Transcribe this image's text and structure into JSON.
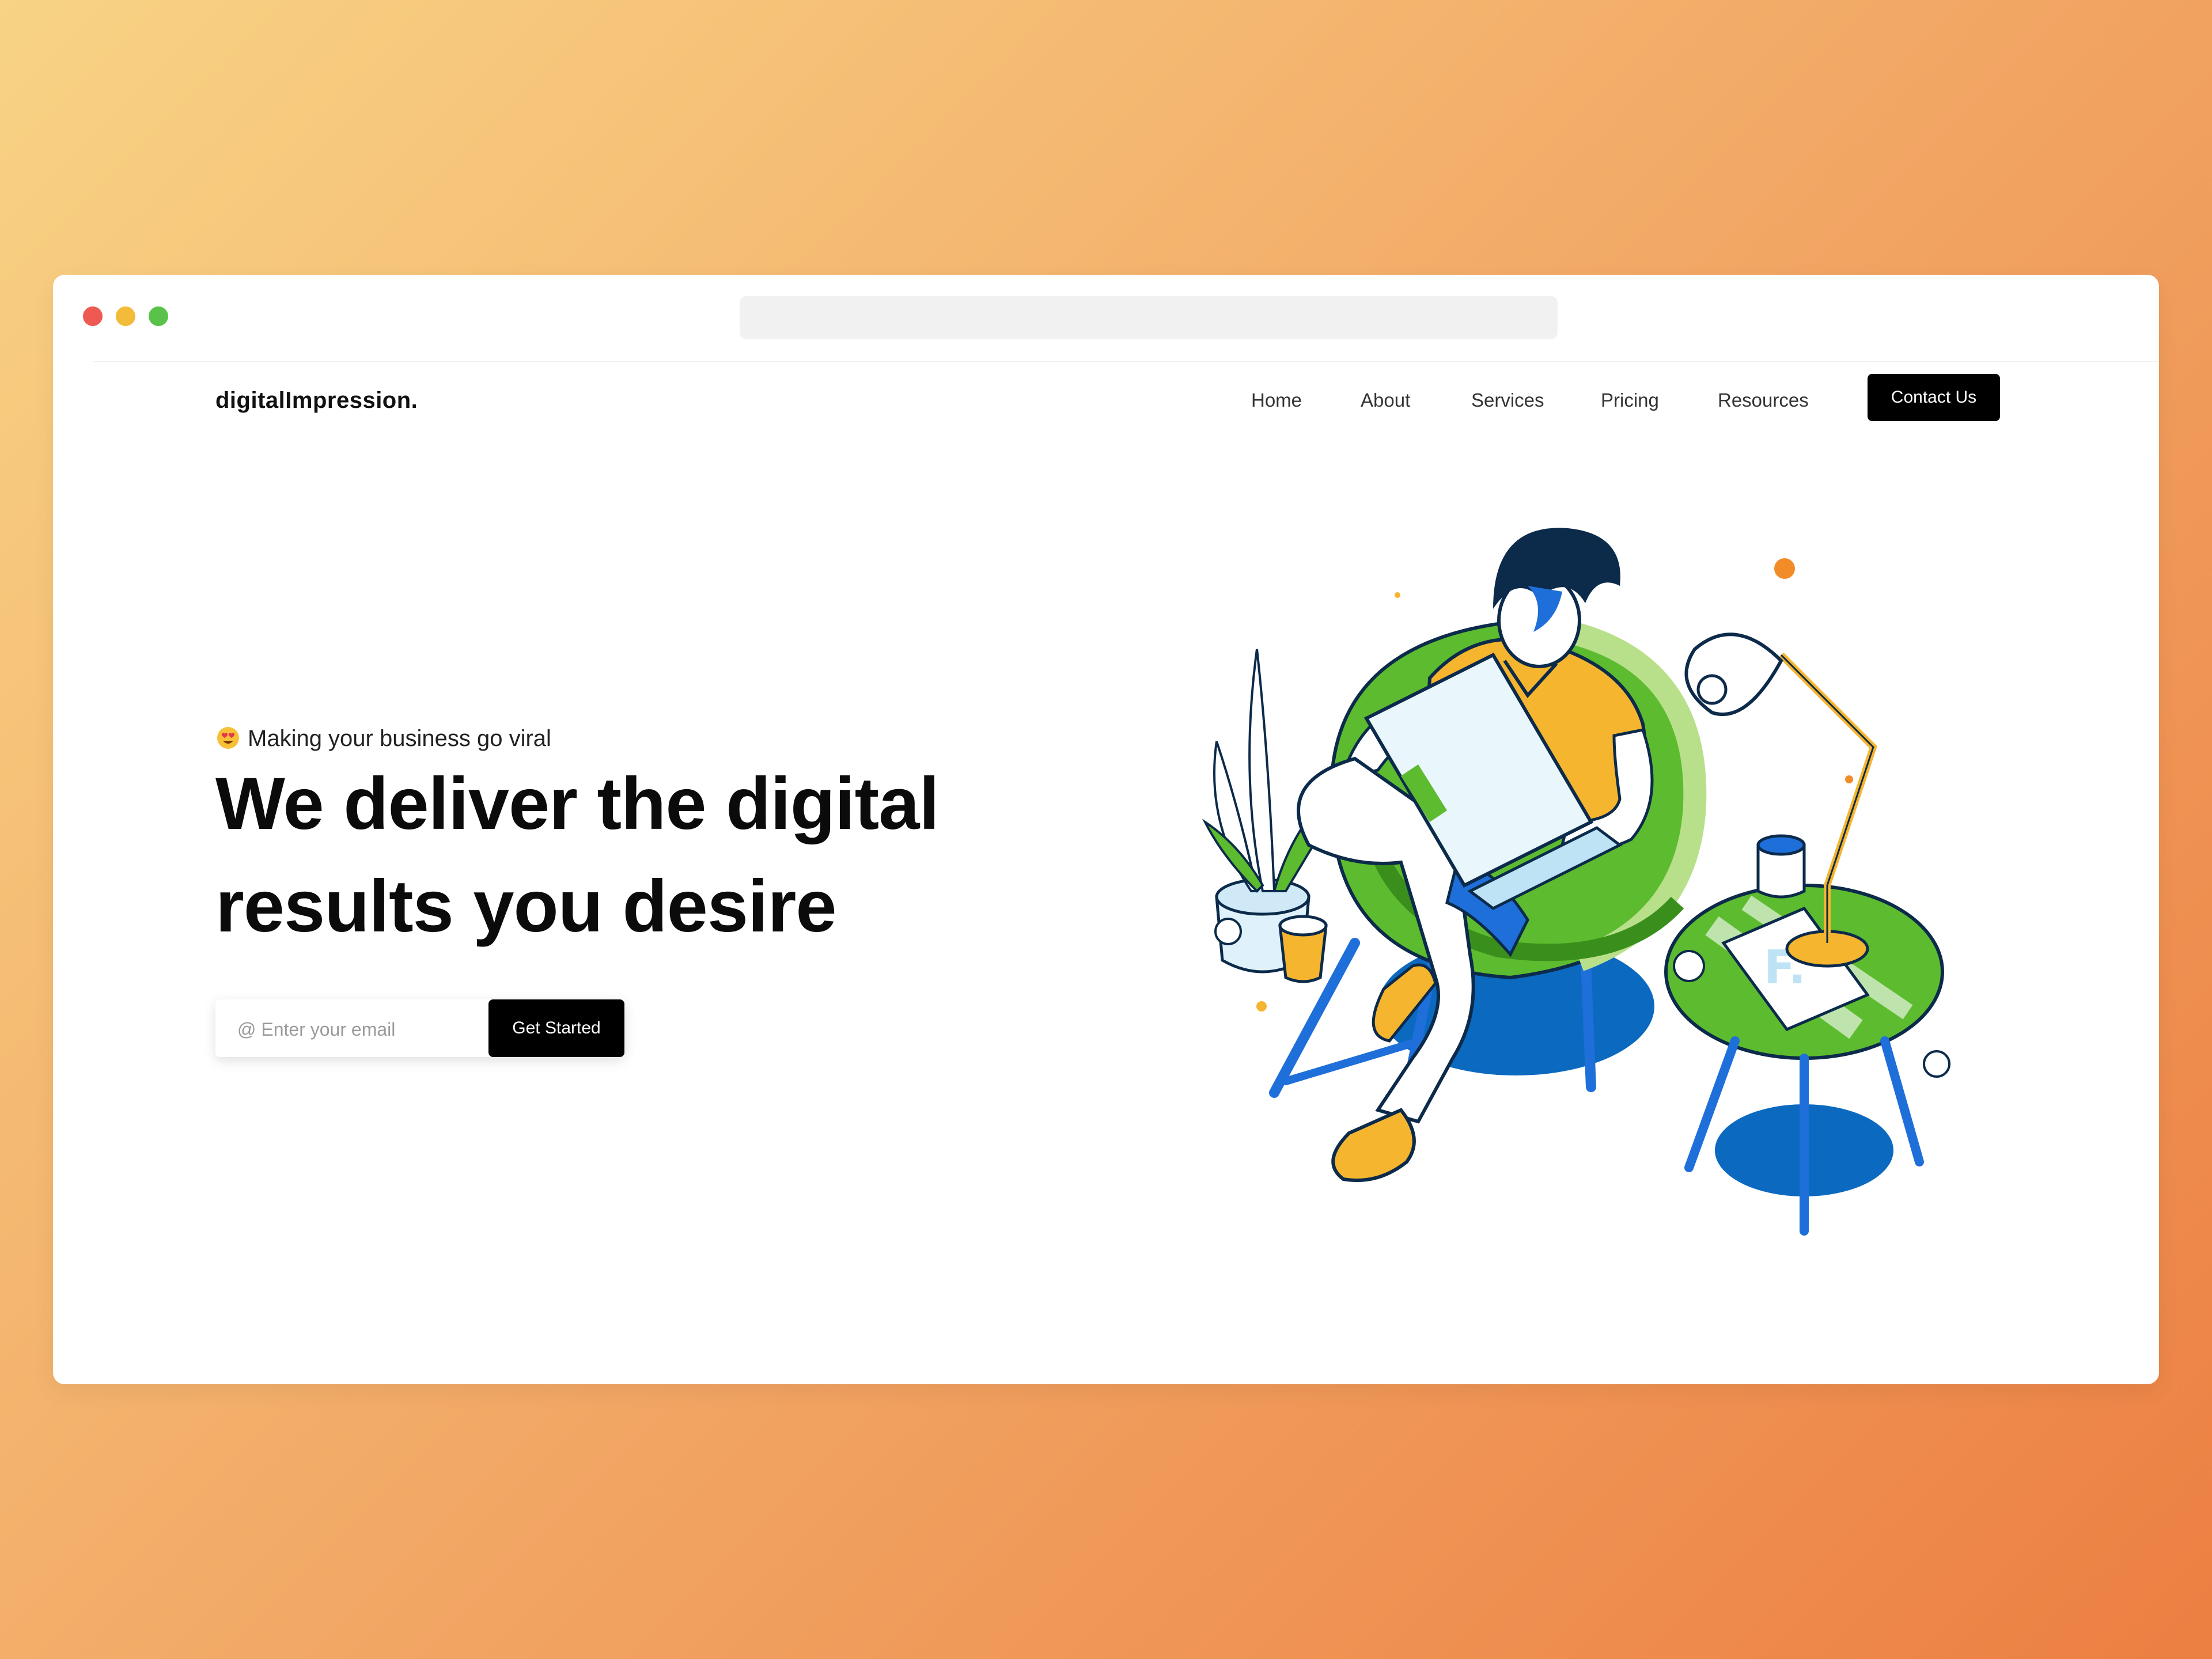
{
  "brand": {
    "logo_text": "digitalImpression."
  },
  "nav": {
    "items": [
      {
        "label": "Home"
      },
      {
        "label": "About"
      },
      {
        "label": "Services"
      },
      {
        "label": "Pricing"
      },
      {
        "label": "Resources"
      }
    ],
    "contact_label": "Contact Us"
  },
  "hero": {
    "tagline_icon": "heart-eyes-emoji-icon",
    "tagline": "Making your business go viral",
    "headline_line1": "We deliver the digital",
    "headline_line2": "results you desire",
    "email_placeholder": "@ Enter your email",
    "email_value": "",
    "cta_label": "Get Started"
  },
  "illustration": {
    "subject": "person-on-beanbag-with-laptop-illustration",
    "colors": {
      "chair": "#5dbb2f",
      "shirt": "#f5b52e",
      "pants": "#1e6fd9",
      "shadow": "#0b69c0"
    }
  },
  "window": {
    "controls": [
      "close-dot",
      "minimize-dot",
      "maximize-dot"
    ],
    "colors": {
      "close": "#ee5a52",
      "minimize": "#f2bc3a",
      "maximize": "#5ac24b"
    }
  }
}
